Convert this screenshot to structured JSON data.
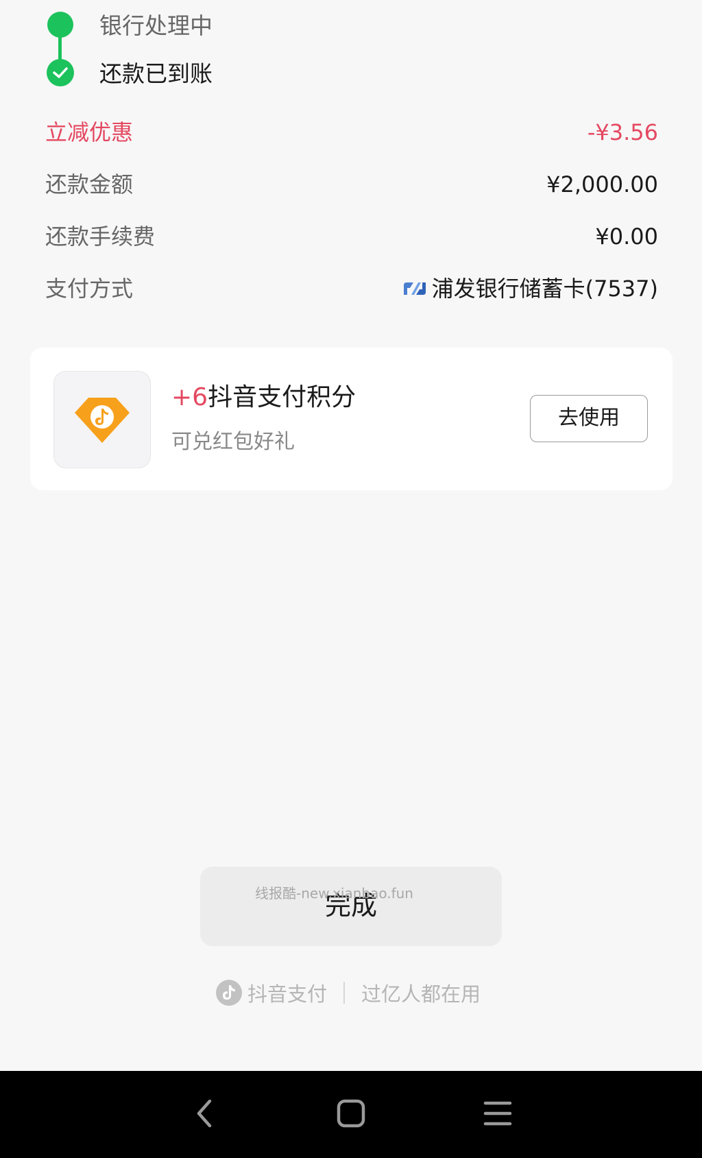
{
  "progress": {
    "steps": [
      {
        "label": "银行处理中"
      },
      {
        "label": "还款已到账"
      }
    ]
  },
  "details": {
    "discount": {
      "label": "立减优惠",
      "value": "-¥3.56"
    },
    "amount": {
      "label": "还款金额",
      "value": "¥2,000.00"
    },
    "fee": {
      "label": "还款手续费",
      "value": "¥0.00"
    },
    "payment_method": {
      "label": "支付方式",
      "value": "浦发银行储蓄卡(7537)",
      "icon": "spdb-bank-icon"
    }
  },
  "points_card": {
    "points": "+6",
    "title": "抖音支付积分",
    "subtitle": "可兑红包好礼",
    "button_label": "去使用",
    "icon": "douyin-points-icon"
  },
  "done_button": {
    "label": "完成",
    "watermark": "线报酷-new.xianbao.fun"
  },
  "footer": {
    "brand": "抖音支付",
    "slogan": "过亿人都在用"
  },
  "colors": {
    "accent_green": "#1cc25c",
    "discount_red": "#e44860",
    "points_orange": "#f7a01c"
  },
  "navbar": {
    "buttons": [
      "back-icon",
      "home-icon",
      "recent-apps-icon"
    ]
  }
}
